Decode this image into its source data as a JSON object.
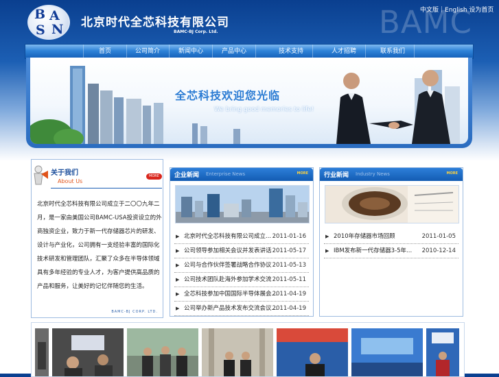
{
  "header": {
    "logo_letters": [
      "B",
      "A",
      "S",
      "N"
    ],
    "company_name_cn": "北京时代全芯科技有限公司",
    "company_name_en": "BAMC-BJ Corp. Ltd.",
    "watermark": "BAMC",
    "lang_links": [
      "中文版",
      "English",
      "设为首页"
    ],
    "lang_sep": "｜"
  },
  "nav": {
    "items": [
      "首页",
      "公司简介",
      "新闻中心",
      "产品中心",
      "技术支持",
      "人才招聘",
      "联系我们"
    ]
  },
  "banner": {
    "slogan_cn": "全芯科技欢迎您光临",
    "slogan_en": "We bring good memories to life!"
  },
  "about": {
    "title_cn": "关于我们",
    "title_en": "About Us",
    "more": "MORE",
    "body": "北京时代全芯科技有限公司成立于二〇〇九年二月，是一家由美国公司BAMC-USA投资设立的外商独资企业，致力于新一代存储器芯片的研发、设计与产业化，公司拥有一支经验丰富的国际化技术研发和管理团队，汇聚了众多在半导体领域具有多年经验的专业人才，为客户提供高品质的产品和服务，让美好的记忆伴随您的生活。",
    "footer": "BAMC-BJ CORP. LTD."
  },
  "enterprise_news": {
    "title_cn": "企业新闻",
    "title_en": "Enterprise News",
    "more": "MORE",
    "items": [
      {
        "title": "北京时代全芯科技有限公司成立...",
        "date": "2011-01-16"
      },
      {
        "title": "公司领导参加相关会议并发表讲话",
        "date": "2011-05-17"
      },
      {
        "title": "公司与合作伙伴签署战略合作协议",
        "date": "2011-05-13"
      },
      {
        "title": "公司技术团队赴海外参加学术交流",
        "date": "2011-05-11"
      },
      {
        "title": "全芯科技参加中国国际半导体展会...",
        "date": "2011-04-19"
      },
      {
        "title": "公司举办新产品技术发布交流会议...",
        "date": "2011-04-19"
      }
    ]
  },
  "industry_news": {
    "title_cn": "行业新闻",
    "title_en": "Industry News",
    "more": "MORE",
    "items": [
      {
        "title": "2010年存储器市场回顾",
        "date": "2011-01-05"
      },
      {
        "title": "IBM发布新一代存储器3-5年...",
        "date": "2010-12-14"
      }
    ]
  },
  "colors": {
    "brand_blue": "#0a3f8f",
    "nav_blue": "#2f83d8",
    "accent_orange": "#e0531a",
    "more_red": "#d9261c"
  }
}
